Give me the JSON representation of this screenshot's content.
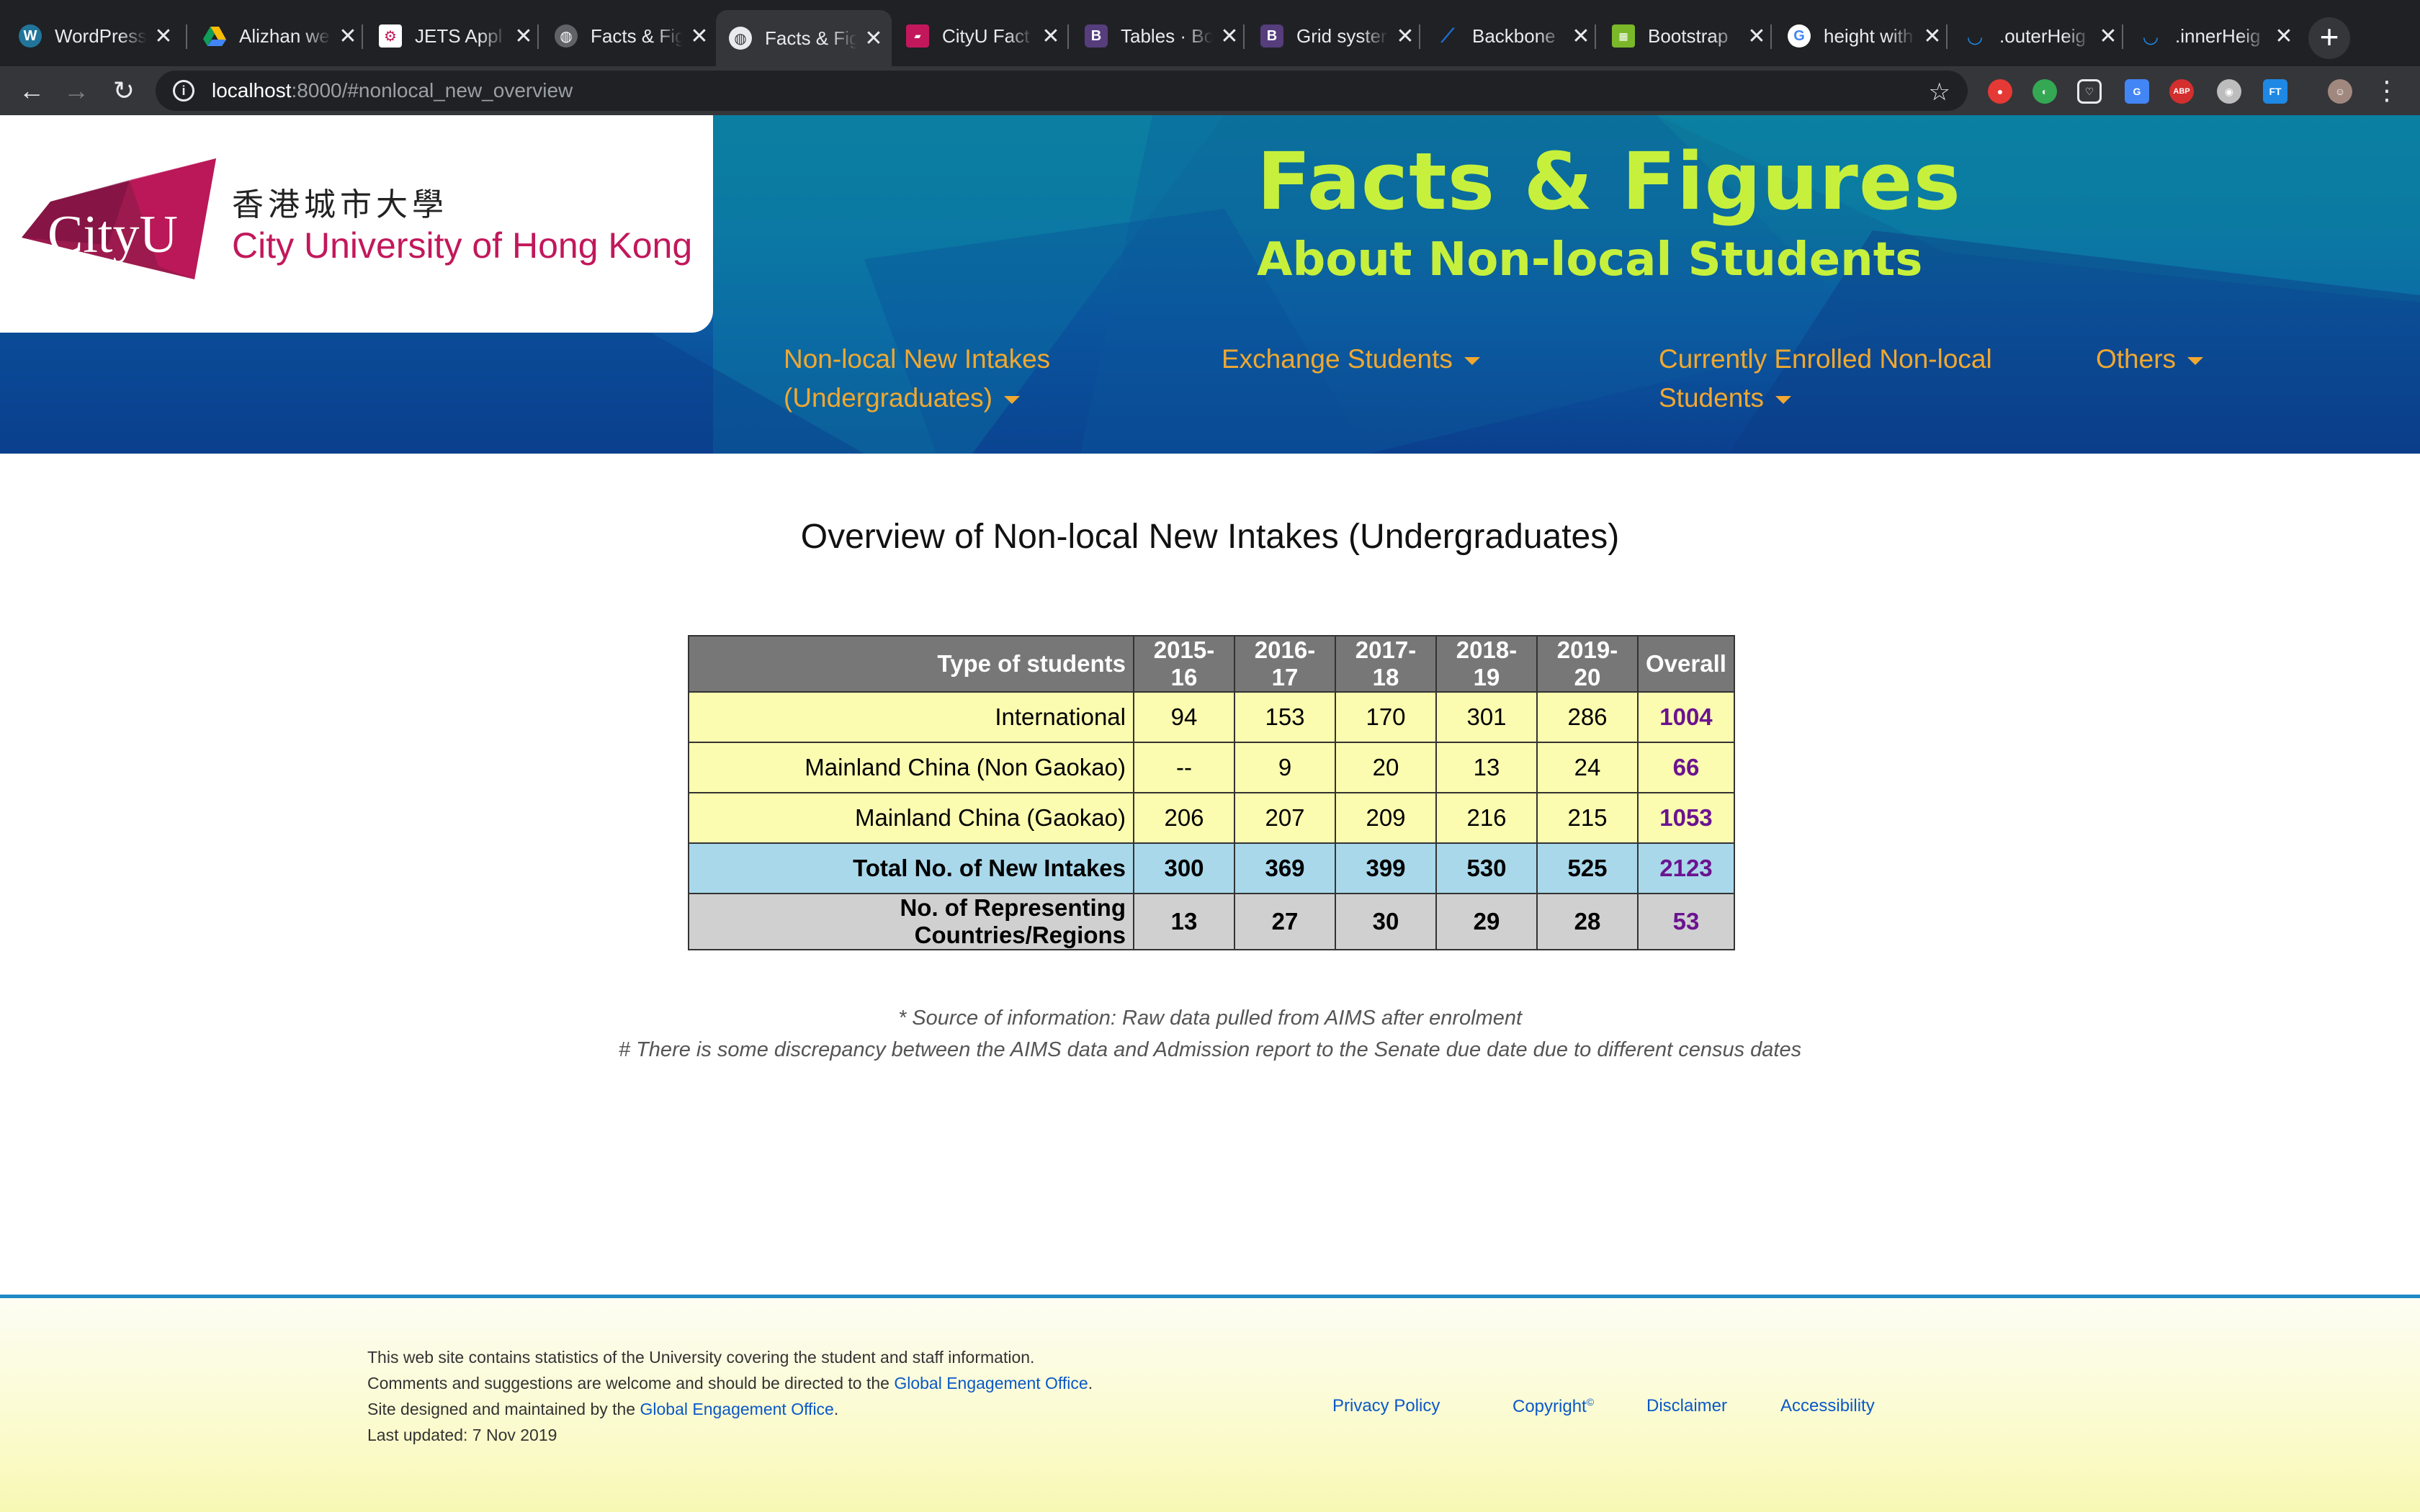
{
  "browser": {
    "tabs": [
      {
        "title": "WordPress",
        "icon": "wordpress-icon",
        "active": false
      },
      {
        "title": "Alizhan we",
        "icon": "google-drive-icon",
        "active": false
      },
      {
        "title": "JETS Appl",
        "icon": "jets-icon",
        "active": false
      },
      {
        "title": "Facts & Fig",
        "icon": "globe-icon",
        "active": false
      },
      {
        "title": "Facts & Fig",
        "icon": "globe-icon",
        "active": true
      },
      {
        "title": "CityU Fact",
        "icon": "cityu-icon",
        "active": false
      },
      {
        "title": "Tables · Bo",
        "icon": "bootstrap-icon",
        "active": false
      },
      {
        "title": "Grid syster",
        "icon": "bootstrap-icon",
        "active": false
      },
      {
        "title": "Backbone",
        "icon": "backbone-icon",
        "active": false
      },
      {
        "title": "Bootstrap",
        "icon": "bootstrap-tables-icon",
        "active": false
      },
      {
        "title": "height with",
        "icon": "google-icon",
        "active": false
      },
      {
        "title": ".outerHeig",
        "icon": "jquery-icon",
        "active": false
      },
      {
        "title": ".innerHeig",
        "icon": "jquery-icon",
        "active": false
      }
    ],
    "url_host": "localhost",
    "url_path": ":8000/#nonlocal_new_overview"
  },
  "header": {
    "logo_text": "CityU",
    "logo_chinese": "香港城市大學",
    "logo_english": "City University of Hong Kong",
    "title": "Facts & Figures",
    "subtitle": "About Non-local Students",
    "nav": [
      {
        "line1": "Non-local New Intakes",
        "line2": "(Undergraduates)"
      },
      {
        "line1": "Exchange Students",
        "line2": ""
      },
      {
        "line1": "Currently Enrolled Non-local",
        "line2": "Students"
      },
      {
        "line1": "Others",
        "line2": ""
      }
    ]
  },
  "main": {
    "heading": "Overview of Non-local New Intakes (Undergraduates)",
    "table": {
      "headers": [
        "Type of students",
        "2015-16",
        "2016-17",
        "2017-18",
        "2018-19",
        "2019-20",
        "Overall"
      ],
      "rows": [
        {
          "label": "International",
          "values": [
            "94",
            "153",
            "170",
            "301",
            "286"
          ],
          "overall": "1004"
        },
        {
          "label": "Mainland China (Non Gaokao)",
          "values": [
            "--",
            "9",
            "20",
            "13",
            "24"
          ],
          "overall": "66"
        },
        {
          "label": "Mainland China (Gaokao)",
          "values": [
            "206",
            "207",
            "209",
            "216",
            "215"
          ],
          "overall": "1053"
        },
        {
          "label": "Total No. of New Intakes",
          "values": [
            "300",
            "369",
            "399",
            "530",
            "525"
          ],
          "overall": "2123"
        },
        {
          "label": "No. of Representing Countries/Regions",
          "values": [
            "13",
            "27",
            "30",
            "29",
            "28"
          ],
          "overall": "53"
        }
      ]
    },
    "note_source": "* Source of information: Raw data pulled from AIMS after enrolment",
    "note_discrepancy": "# There is some discrepancy between the AIMS data and Admission report to the Senate due date due to different census dates"
  },
  "footer": {
    "line1": "This web site contains statistics of the University covering the student and staff information.",
    "line2_prefix": "Comments and suggestions are welcome and should be directed to the ",
    "line2_link": "Global Engagement Office",
    "line2_suffix": ".",
    "line3_prefix": "Site designed and maintained by the ",
    "line3_link": "Global Engagement Office",
    "line3_suffix": ".",
    "last_updated": "Last updated: 7 Nov 2019",
    "links": {
      "privacy": "Privacy Policy",
      "copyright": "Copyright",
      "copyright_sup": "©",
      "disclaimer": "Disclaimer",
      "accessibility": "Accessibility"
    }
  },
  "colors": {
    "title": "#c6f03c",
    "nav": "#f0a830",
    "overall": "#6b1390",
    "brand": "#c2185b",
    "total_row": "#a9d8ea",
    "data_rows": "#fcfcb0"
  }
}
